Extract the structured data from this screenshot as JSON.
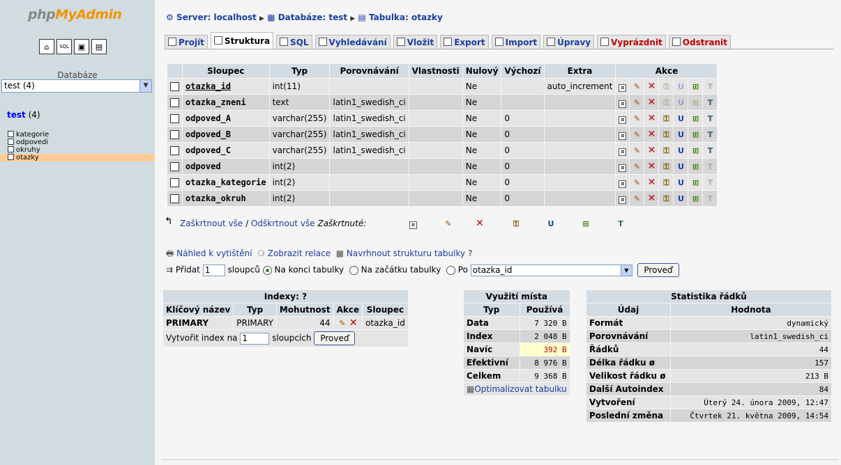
{
  "app": {
    "logo_part1": "php",
    "logo_part2": "MyAdmin"
  },
  "nav_icons": [
    "home-icon",
    "sql-icon",
    "query-window-icon",
    "docs-icon"
  ],
  "sidebar": {
    "db_label": "Databáze",
    "db_select": "test (4)",
    "db_name": "test",
    "db_count": "(4)",
    "tables": [
      "kategorie",
      "odpovedi",
      "okruhy",
      "otazky"
    ],
    "selected": "otazky"
  },
  "breadcrumb": {
    "server": "Server: localhost",
    "database": "Databáze: test",
    "table": "Tabulka: otazky"
  },
  "tabs": [
    {
      "label": "Projít",
      "icon": "browse-icon"
    },
    {
      "label": "Struktura",
      "icon": "structure-icon",
      "active": true
    },
    {
      "label": "SQL",
      "icon": "sql-icon"
    },
    {
      "label": "Vyhledávání",
      "icon": "search-icon"
    },
    {
      "label": "Vložit",
      "icon": "insert-icon"
    },
    {
      "label": "Export",
      "icon": "export-icon"
    },
    {
      "label": "Import",
      "icon": "import-icon"
    },
    {
      "label": "Úpravy",
      "icon": "operations-icon"
    },
    {
      "label": "Vyprázdnit",
      "icon": "empty-icon",
      "red": true
    },
    {
      "label": "Odstranit",
      "icon": "drop-icon",
      "red": true
    }
  ],
  "structure": {
    "headers": [
      "Sloupec",
      "Typ",
      "Porovnávání",
      "Vlastnosti",
      "Nulový",
      "Výchozí",
      "Extra",
      "Akce"
    ],
    "rows": [
      {
        "name": "otazka_id",
        "type": "int(11)",
        "collation": "",
        "attributes": "",
        "null": "Ne",
        "default": "",
        "extra": "auto_increment",
        "primary": true
      },
      {
        "name": "otazka_zneni",
        "type": "text",
        "collation": "latin1_swedish_ci",
        "attributes": "",
        "null": "Ne",
        "default": "",
        "extra": "",
        "text": true
      },
      {
        "name": "odpoved_A",
        "type": "varchar(255)",
        "collation": "latin1_swedish_ci",
        "attributes": "",
        "null": "Ne",
        "default": "0",
        "extra": ""
      },
      {
        "name": "odpoved_B",
        "type": "varchar(255)",
        "collation": "latin1_swedish_ci",
        "attributes": "",
        "null": "Ne",
        "default": "0",
        "extra": ""
      },
      {
        "name": "odpoved_C",
        "type": "varchar(255)",
        "collation": "latin1_swedish_ci",
        "attributes": "",
        "null": "Ne",
        "default": "0",
        "extra": ""
      },
      {
        "name": "odpoved",
        "type": "int(2)",
        "collation": "",
        "attributes": "",
        "null": "Ne",
        "default": "0",
        "extra": ""
      },
      {
        "name": "otazka_kategorie",
        "type": "int(2)",
        "collation": "",
        "attributes": "",
        "null": "Ne",
        "default": "0",
        "extra": ""
      },
      {
        "name": "otazka_okruh",
        "type": "int(2)",
        "collation": "",
        "attributes": "",
        "null": "Ne",
        "default": "0",
        "extra": ""
      }
    ],
    "check_all": "Zaškrtnout vše",
    "separator": "/",
    "uncheck_all": "Odškrtnout vše",
    "with_selected": "Zaškrtnuté:"
  },
  "links": {
    "print": "Náhled k vytištění",
    "relations": "Zobrazit relace",
    "propose": "Navrhnout strukturu tabulky"
  },
  "add_columns": {
    "label": "Přidat",
    "value": "1",
    "suffix": "sloupců",
    "opt_end": "Na konci tabulky",
    "opt_start": "Na začátku tabulky",
    "opt_after": "Po",
    "after_select": "otazka_id",
    "button": "Proveď"
  },
  "indexes": {
    "title": "Indexy:",
    "headers": [
      "Klíčový název",
      "Typ",
      "Mohutnost",
      "Akce",
      "Sloupec"
    ],
    "rows": [
      {
        "name": "PRIMARY",
        "type": "PRIMARY",
        "cardinality": "44",
        "column": "otazka_id"
      }
    ],
    "create_label": "Vytvořit index na",
    "create_value": "1",
    "create_suffix": "sloupcích",
    "button": "Proveď"
  },
  "space": {
    "title": "Využití místa",
    "headers": [
      "Typ",
      "Používá"
    ],
    "rows": [
      {
        "type": "Data",
        "value": "7 320",
        "unit": "B"
      },
      {
        "type": "Index",
        "value": "2 048",
        "unit": "B"
      },
      {
        "type": "Navíc",
        "value": "392",
        "unit": "B",
        "highlight": true
      },
      {
        "type": "Efektivní",
        "value": "8 976",
        "unit": "B"
      },
      {
        "type": "Celkem",
        "value": "9 368",
        "unit": "B"
      }
    ],
    "optimize": "Optimalizovat tabulku"
  },
  "rowstats": {
    "title": "Statistika řádků",
    "headers": [
      "Údaj",
      "Hodnota"
    ],
    "rows": [
      {
        "label": "Formát",
        "value": "dynamický"
      },
      {
        "label": "Porovnávání",
        "value": "latin1_swedish_ci"
      },
      {
        "label": "Řádků",
        "value": "44"
      },
      {
        "label": "Délka řádku ø",
        "value": "157"
      },
      {
        "label": "Velikost řádku ø",
        "value": "213 B"
      },
      {
        "label": "Další Autoindex",
        "value": "84"
      },
      {
        "label": "Vytvoření",
        "value": "Úterý 24. února 2009, 12:47"
      },
      {
        "label": "Poslední změna",
        "value": "Čtvrtek 21. května 2009, 14:54"
      }
    ]
  }
}
